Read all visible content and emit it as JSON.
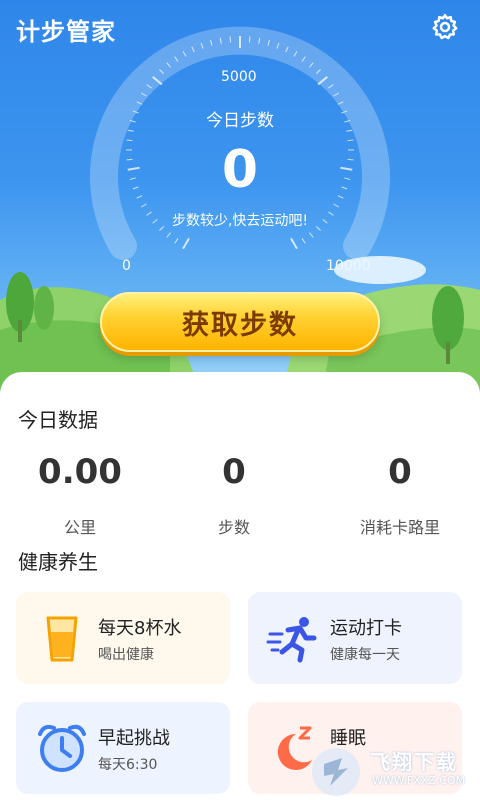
{
  "header": {
    "title": "计步管家",
    "settings_icon": "gear-icon"
  },
  "gauge": {
    "label": "今日步数",
    "value": "0",
    "hint": "步数较少,快去运动吧!",
    "tick_min": "0",
    "tick_mid": "5000",
    "tick_max": "10000"
  },
  "action_button": "获取步数",
  "today": {
    "title": "今日数据",
    "stats": [
      {
        "value": "0.00",
        "label": "公里"
      },
      {
        "value": "0",
        "label": "步数"
      },
      {
        "value": "0",
        "label": "消耗卡路里"
      }
    ]
  },
  "health": {
    "title": "健康养生",
    "cards": [
      {
        "title": "每天8杯水",
        "subtitle": "喝出健康",
        "icon": "water-glass-icon"
      },
      {
        "title": "运动打卡",
        "subtitle": "健康每一天",
        "icon": "running-icon"
      },
      {
        "title": "早起挑战",
        "subtitle": "每天6:30",
        "icon": "alarm-clock-icon"
      },
      {
        "title": "睡眠",
        "subtitle": "",
        "icon": "moon-sleep-icon"
      }
    ]
  },
  "watermark": {
    "name": "飞翔下载",
    "url": "WWW.FXXZ.COM"
  },
  "colors": {
    "sky": "#3d95ef",
    "button": "#ffc21a",
    "button_text": "#7a3a00",
    "grass": "#7cc95e"
  }
}
